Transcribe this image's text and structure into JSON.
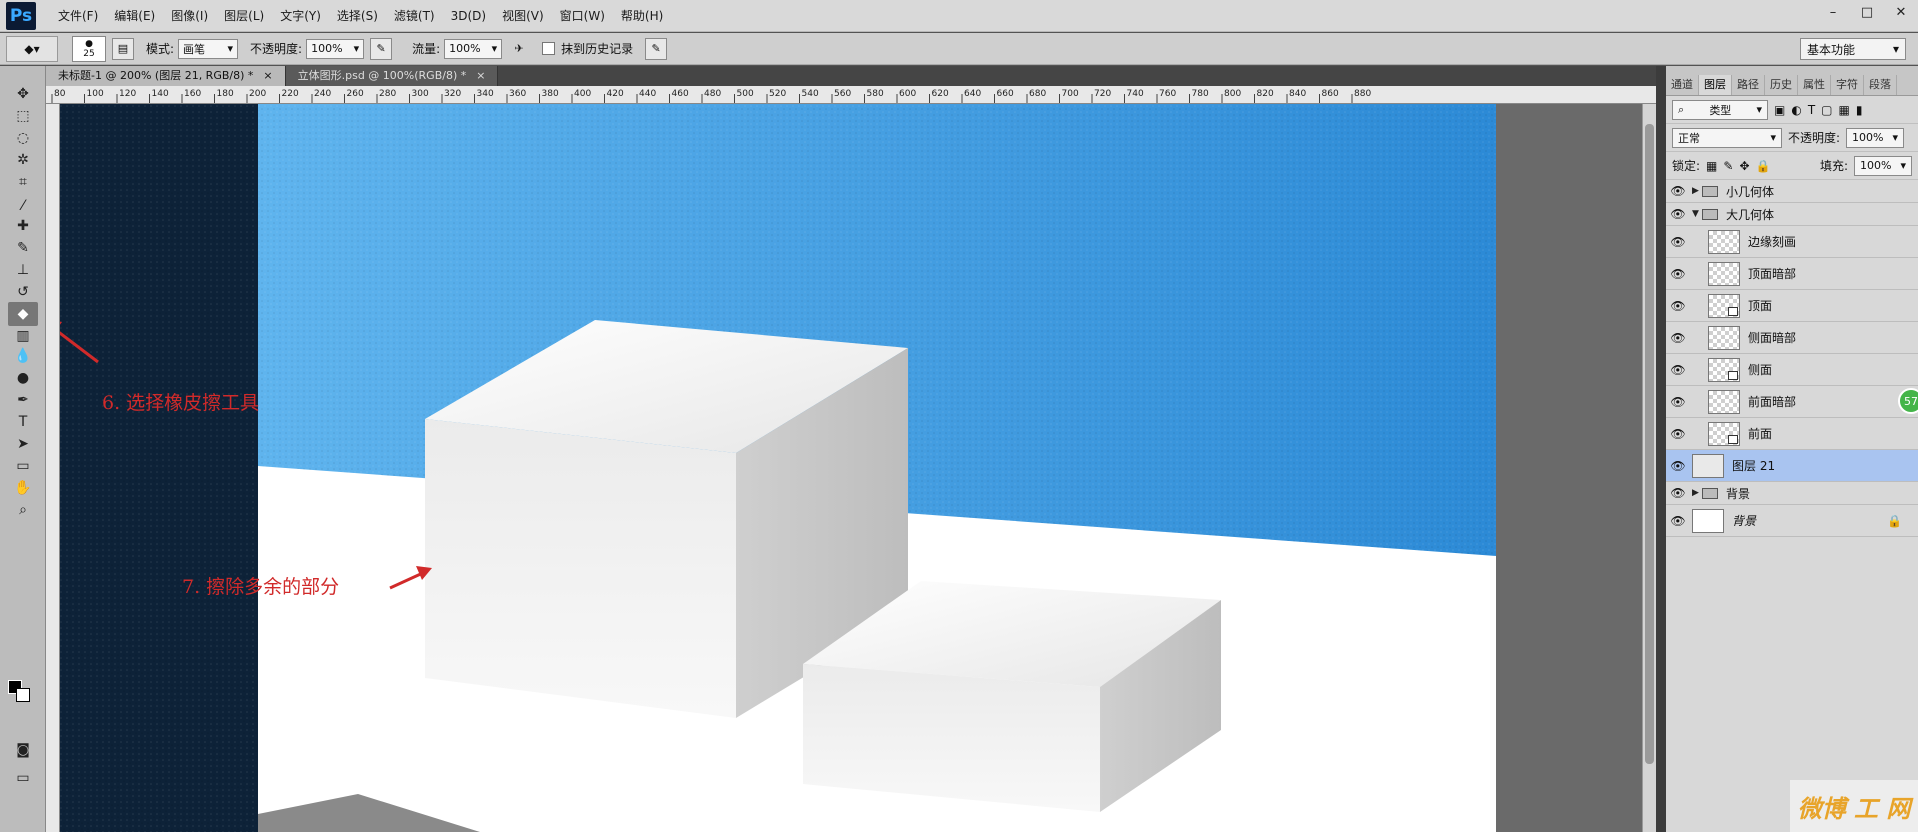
{
  "app": {
    "logo": "Ps"
  },
  "menu": [
    "文件(F)",
    "编辑(E)",
    "图像(I)",
    "图层(L)",
    "文字(Y)",
    "选择(S)",
    "滤镜(T)",
    "3D(D)",
    "视图(V)",
    "窗口(W)",
    "帮助(H)"
  ],
  "window_controls": {
    "minimize": "–",
    "restore": "□",
    "close": "✕"
  },
  "options": {
    "brush_size": "25",
    "mode_label": "模式:",
    "mode_value": "画笔",
    "opacity_label": "不透明度:",
    "opacity_value": "100%",
    "flow_label": "流量:",
    "flow_value": "100%",
    "history_label": "抹到历史记录",
    "workspace": "基本功能"
  },
  "tabs": [
    {
      "title": "未标题-1 @ 200% (图层 21, RGB/8) *",
      "close": "×",
      "active": true
    },
    {
      "title": "立体图形.psd @ 100%(RGB/8) *",
      "close": "×",
      "active": false
    }
  ],
  "ruler_ticks": [
    "80",
    "100",
    "120",
    "140",
    "160",
    "180",
    "200",
    "220",
    "240",
    "260",
    "280",
    "300",
    "320",
    "340",
    "360",
    "380",
    "400",
    "420",
    "440",
    "460",
    "480",
    "500",
    "520",
    "540",
    "560",
    "580",
    "600",
    "620",
    "640",
    "660",
    "680",
    "700",
    "720",
    "740",
    "760",
    "780",
    "800",
    "820",
    "840",
    "860",
    "880"
  ],
  "tools": [
    "move-tool-icon",
    "marquee-tool-icon",
    "lasso-tool-icon",
    "quick-select-tool-icon",
    "crop-tool-icon",
    "eyedropper-tool-icon",
    "healing-brush-tool-icon",
    "brush-tool-icon",
    "clone-stamp-tool-icon",
    "history-brush-tool-icon",
    "eraser-tool-icon",
    "gradient-tool-icon",
    "blur-tool-icon",
    "dodge-tool-icon",
    "pen-tool-icon",
    "type-tool-icon",
    "path-select-tool-icon",
    "rectangle-tool-icon",
    "hand-tool-icon",
    "zoom-tool-icon"
  ],
  "annotations": {
    "step6": "6. 选择橡皮擦工具",
    "step7": "7. 擦除多余的部分"
  },
  "layers_panel": {
    "tabs": [
      "通道",
      "图层",
      "路径",
      "历史",
      "属性",
      "字符",
      "段落"
    ],
    "active_tab": "图层",
    "filter_label": "类型",
    "blend_mode": "正常",
    "opacity_label": "不透明度:",
    "opacity_value": "100%",
    "lock_label": "锁定:",
    "fill_label": "填充:",
    "fill_value": "100%",
    "layers": [
      {
        "name": "小几何体",
        "kind": "group",
        "expanded": false
      },
      {
        "name": "大几何体",
        "kind": "group",
        "expanded": true
      },
      {
        "name": "边缘刻画",
        "kind": "layer"
      },
      {
        "name": "顶面暗部",
        "kind": "layer"
      },
      {
        "name": "顶面",
        "kind": "masked"
      },
      {
        "name": "侧面暗部",
        "kind": "layer"
      },
      {
        "name": "侧面",
        "kind": "masked"
      },
      {
        "name": "前面暗部",
        "kind": "layer"
      },
      {
        "name": "前面",
        "kind": "masked"
      },
      {
        "name": "图层 21",
        "kind": "selected"
      },
      {
        "name": "背景",
        "kind": "group",
        "expanded": false
      },
      {
        "name": "背景",
        "kind": "background"
      }
    ]
  },
  "badge": "57",
  "watermark": "微博 工 网",
  "colors": {
    "sky": "#3a9be3",
    "dark_panel": "#0d2238",
    "floor": "#ffffff",
    "accent_red": "#d12a2a",
    "selection": "#a9c4f0"
  }
}
